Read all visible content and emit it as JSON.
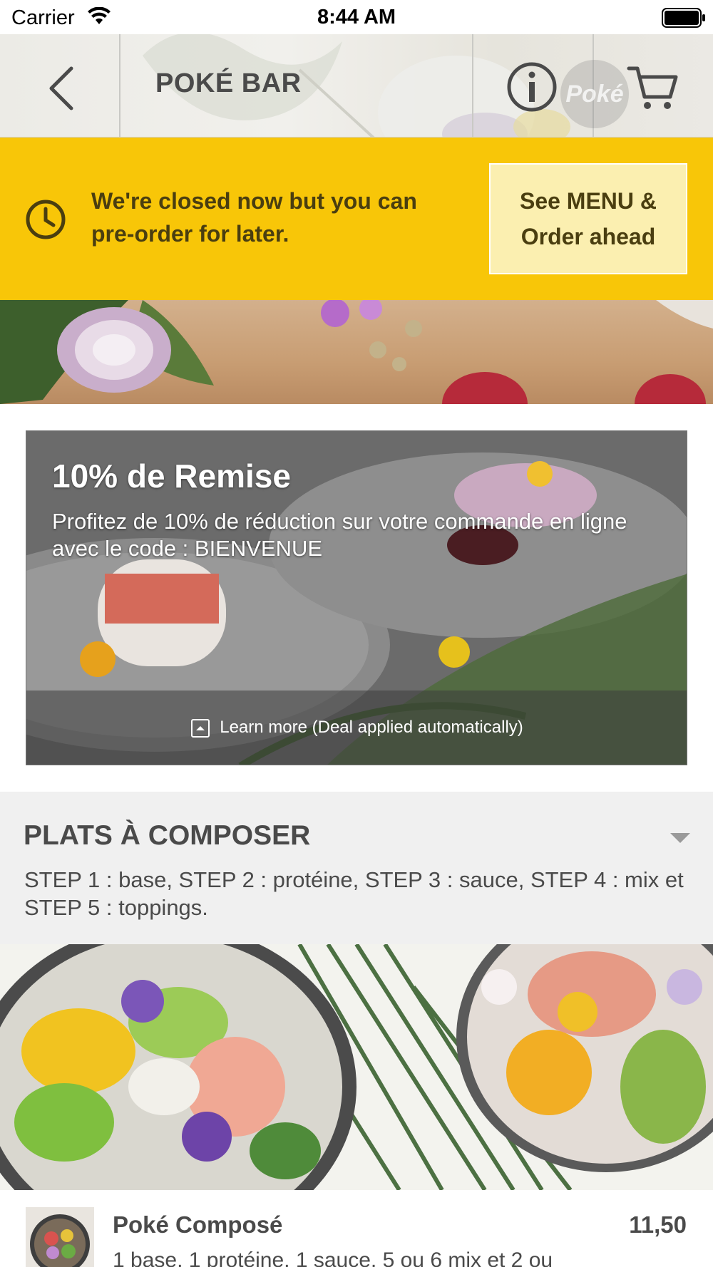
{
  "status_bar": {
    "carrier": "Carrier",
    "time": "8:44 AM"
  },
  "nav": {
    "title": "POKÉ BAR",
    "back_icon": "chevron-left-icon",
    "info_icon": "info-icon",
    "cart_icon": "cart-icon",
    "logo_text": "Poké"
  },
  "closed_banner": {
    "message": "We're closed now but you can pre-order for later.",
    "button_line1": "See MENU &",
    "button_line2": "Order ahead",
    "icon": "clock-icon",
    "color": "#f8c608"
  },
  "deal": {
    "title": "10% de Remise",
    "description": "Profitez de 10% de réduction sur votre commande en ligne avec le code : BIENVENUE",
    "learn_more": "Learn more (Deal applied automatically)"
  },
  "category": {
    "title": "PLATS À COMPOSER",
    "description": "STEP 1 : base, STEP 2 : protéine, STEP 3 : sauce, STEP 4 : mix et STEP 5 : toppings."
  },
  "items": [
    {
      "name": "Poké Composé",
      "price": "11,50",
      "description": "1 base, 1 protéine, 1 sauce, 5 ou 6 mix et 2 ou"
    }
  ]
}
